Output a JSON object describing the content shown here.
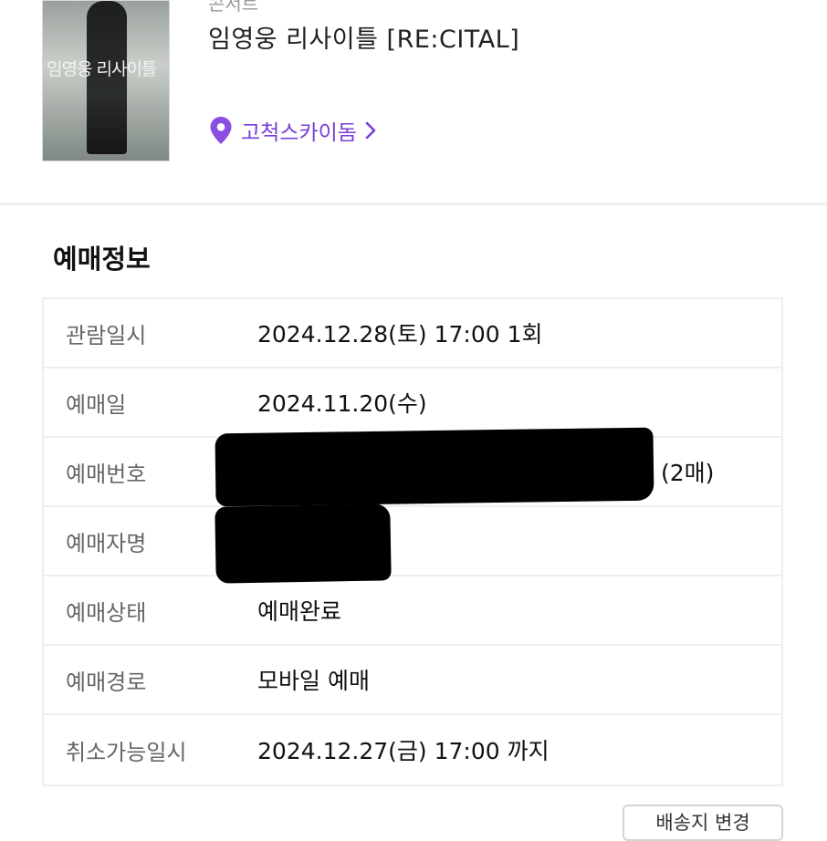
{
  "performance": {
    "poster_text": "임영웅 리사이틀",
    "category": "콘서트",
    "title": "임영웅 리사이틀 [RE:CITAL]",
    "venue": "고척스카이돔",
    "venue_icon": "location-pin-icon",
    "accent_color": "#7a3ed6"
  },
  "booking": {
    "section_title": "예매정보",
    "rows": [
      {
        "label": "관람일시",
        "value": "2024.12.28(토) 17:00 1회"
      },
      {
        "label": "예매일",
        "value": "2024.11.20(수)"
      },
      {
        "label": "예매번호",
        "value": "",
        "suffix": "(2매)"
      },
      {
        "label": "예매자명",
        "value": ""
      },
      {
        "label": "예매상태",
        "value": "예매완료"
      },
      {
        "label": "예매경로",
        "value": "모바일 예매"
      },
      {
        "label": "취소가능일시",
        "value": "2024.12.27(금) 17:00 까지"
      }
    ]
  },
  "footer": {
    "button_label": "배송지 변경"
  }
}
